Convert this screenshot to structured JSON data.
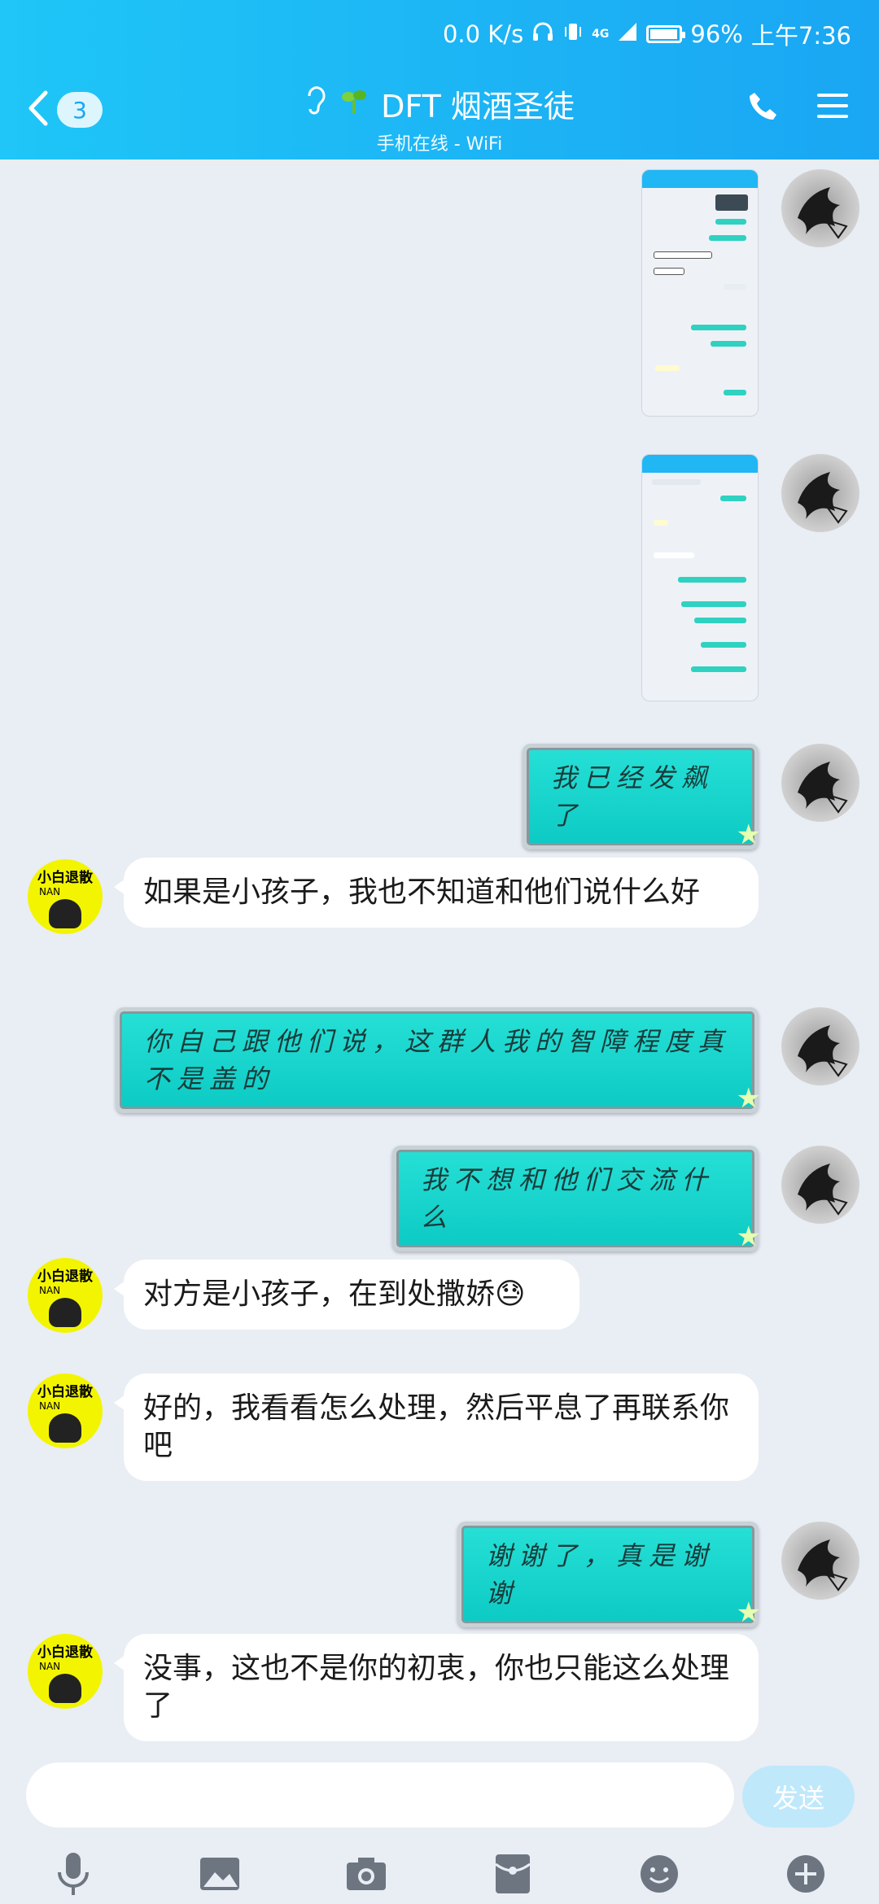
{
  "status_bar": {
    "net_speed": "0.0 K/s",
    "network": "4G",
    "battery": "96%",
    "battery_level": 0.96,
    "time": "上午7:36"
  },
  "header": {
    "back_count": "3",
    "title": "DFT 烟酒圣徒",
    "subtitle": "手机在线 - WiFi",
    "icons": [
      "ear-icon",
      "sprout-icon",
      "phone-icon",
      "menu-icon"
    ]
  },
  "messages": [
    {
      "side": "right",
      "type": "image",
      "avatar": "raven-avatar"
    },
    {
      "side": "right",
      "type": "image",
      "avatar": "raven-avatar"
    },
    {
      "side": "right",
      "type": "text",
      "text": "我已经发飙了"
    },
    {
      "side": "left",
      "type": "text",
      "text": "如果是小孩子，我也不知道和他们说什么好"
    },
    {
      "side": "right",
      "type": "text",
      "text": "你自己跟他们说，这群人我的智障程度真不是盖的"
    },
    {
      "side": "right",
      "type": "text",
      "text": "我不想和他们交流什么"
    },
    {
      "side": "left",
      "type": "text",
      "text": "对方是小孩子，在到处撒娇😓"
    },
    {
      "side": "left",
      "type": "text",
      "text": "好的，我看看怎么处理，然后平息了再联系你吧"
    },
    {
      "side": "right",
      "type": "text",
      "text": "谢谢了，真是谢谢"
    },
    {
      "side": "left",
      "type": "text",
      "text": "没事，这也不是你的初衷，你也只能这么处理了"
    }
  ],
  "left_avatar_text": "小白退散",
  "left_avatar_sub": "NAN",
  "input": {
    "value": "",
    "placeholder": "",
    "send_label": "发送"
  },
  "toolbar": [
    "microphone-icon",
    "image-icon",
    "camera-icon",
    "red-packet-icon",
    "emoji-icon",
    "plus-icon"
  ],
  "colors": {
    "header": "#1fc6f7",
    "bubble_teal": "#17d3cc",
    "background": "#e9edf4"
  }
}
